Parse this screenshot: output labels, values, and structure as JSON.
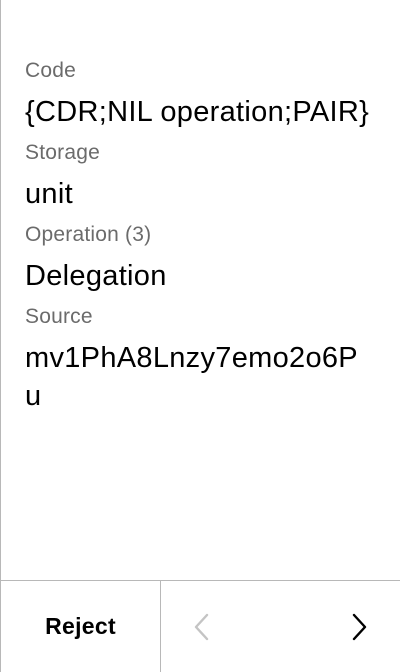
{
  "fields": [
    {
      "label": "Code",
      "value": "{CDR;NIL operation;PAIR}"
    },
    {
      "label": "Storage",
      "value": "unit"
    },
    {
      "label": "Operation (3)",
      "value": "Delegation"
    },
    {
      "label": "Source",
      "value": "mv1PhA8Lnzy7emo2o6Pu"
    }
  ],
  "footer": {
    "reject_label": "Reject",
    "prev_icon": "chevron-left-icon",
    "next_icon": "chevron-right-icon",
    "prev_color": "#c4c4c4",
    "next_color": "#000000"
  }
}
